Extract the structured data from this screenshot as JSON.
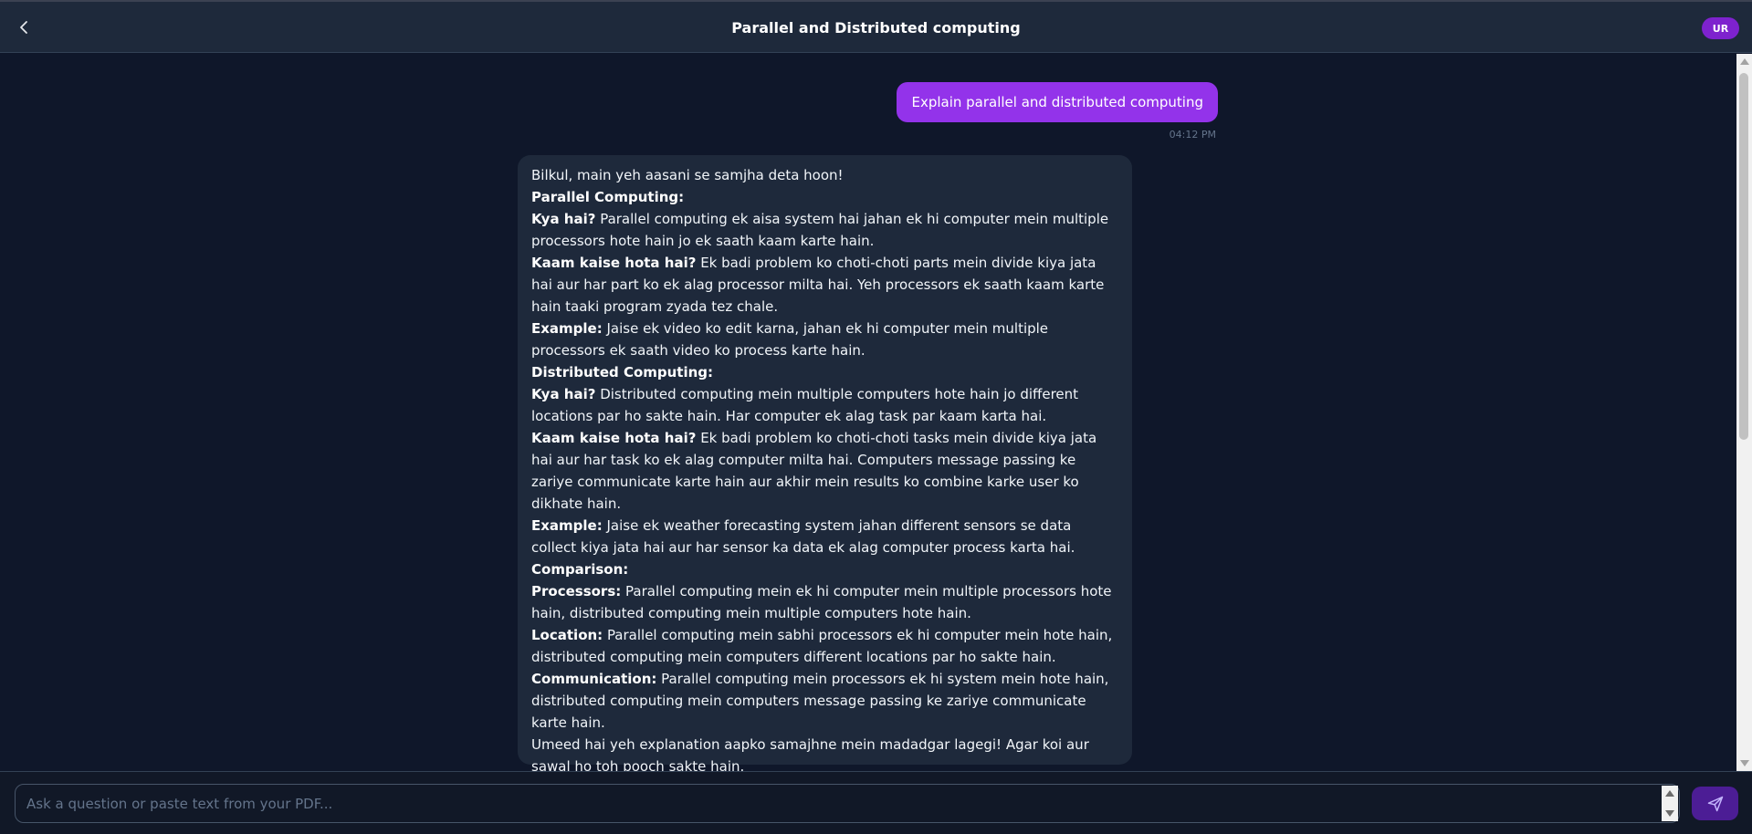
{
  "header": {
    "title": "Parallel and Distributed computing",
    "avatar_initials": "UR",
    "back_icon": "chevron-left-icon"
  },
  "messages": {
    "user": {
      "text": "Explain parallel and distributed computing",
      "time": "04:12 PM"
    },
    "assistant": {
      "lines": [
        {
          "bold": "",
          "text": "Bilkul, main yeh aasani se samjha deta hoon!"
        },
        {
          "bold": "Parallel Computing:",
          "text": ""
        },
        {
          "bold": "Kya hai?",
          "text": " Parallel computing ek aisa system hai jahan ek hi computer mein multiple processors hote hain jo ek saath kaam karte hain."
        },
        {
          "bold": "Kaam kaise hota hai?",
          "text": " Ek badi problem ko choti-choti parts mein divide kiya jata hai aur har part ko ek alag processor milta hai. Yeh processors ek saath kaam karte hain taaki program zyada tez chale."
        },
        {
          "bold": "Example:",
          "text": " Jaise ek video ko edit karna, jahan ek hi computer mein multiple processors ek saath video ko process karte hain."
        },
        {
          "bold": "Distributed Computing:",
          "text": ""
        },
        {
          "bold": "Kya hai?",
          "text": " Distributed computing mein multiple computers hote hain jo different locations par ho sakte hain. Har computer ek alag task par kaam karta hai."
        },
        {
          "bold": "Kaam kaise hota hai?",
          "text": " Ek badi problem ko choti-choti tasks mein divide kiya jata hai aur har task ko ek alag computer milta hai. Computers message passing ke zariye communicate karte hain aur akhir mein results ko combine karke user ko dikhate hain."
        },
        {
          "bold": "Example:",
          "text": " Jaise ek weather forecasting system jahan different sensors se data collect kiya jata hai aur har sensor ka data ek alag computer process karta hai."
        },
        {
          "bold": "Comparison:",
          "text": ""
        },
        {
          "bold": "Processors:",
          "text": " Parallel computing mein ek hi computer mein multiple processors hote hain, distributed computing mein multiple computers hote hain."
        },
        {
          "bold": "Location:",
          "text": " Parallel computing mein sabhi processors ek hi computer mein hote hain, distributed computing mein computers different locations par ho sakte hain."
        },
        {
          "bold": "Communication:",
          "text": " Parallel computing mein processors ek hi system mein hote hain, distributed computing mein computers message passing ke zariye communicate karte hain."
        },
        {
          "bold": "",
          "text": "Umeed hai yeh explanation aapko samajhne mein madadgar lagegi! Agar koi aur sawal ho toh pooch sakte hain."
        }
      ]
    }
  },
  "composer": {
    "placeholder": "Ask a question or paste text from your PDF...",
    "value": "",
    "send_icon": "send-icon"
  },
  "colors": {
    "background": "#0f172a",
    "header": "#1e293b",
    "user_bubble": "#9333ea",
    "assistant_bubble": "#1e293b",
    "avatar": "#7e22ce",
    "send_button": "#4c1d95"
  }
}
